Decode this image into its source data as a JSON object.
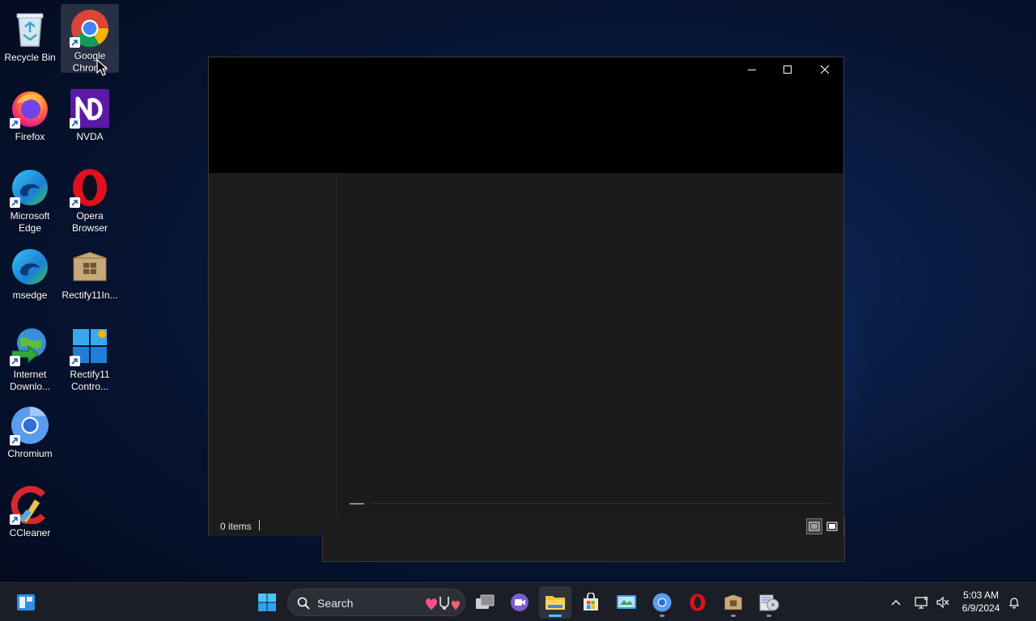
{
  "desktop": {
    "icons": [
      {
        "label": "Recycle Bin",
        "name": "recycle-bin"
      },
      {
        "label": "Google Chrome",
        "name": "google-chrome"
      },
      {
        "label": "Firefox",
        "name": "firefox"
      },
      {
        "label": "NVDA",
        "name": "nvda"
      },
      {
        "label": "Microsoft Edge",
        "name": "microsoft-edge"
      },
      {
        "label": "Opera Browser",
        "name": "opera-browser"
      },
      {
        "label": "msedge",
        "name": "msedge"
      },
      {
        "label": "Rectify11In...",
        "name": "rectify11-installer"
      },
      {
        "label": "Internet Downlo...",
        "name": "internet-download-manager"
      },
      {
        "label": "Rectify11 Contro...",
        "name": "rectify11-control"
      },
      {
        "label": "Chromium",
        "name": "chromium"
      },
      {
        "label": "CCleaner",
        "name": "ccleaner"
      }
    ]
  },
  "window": {
    "minimize": "—",
    "maximize": "☐",
    "close": "✕",
    "status": {
      "items": "0 items"
    }
  },
  "taskbar": {
    "search": {
      "placeholder": "Search"
    },
    "clock": {
      "time": "5:03 AM",
      "date": "6/9/2024"
    },
    "colors": {
      "accent": "#4cc2ff"
    }
  }
}
